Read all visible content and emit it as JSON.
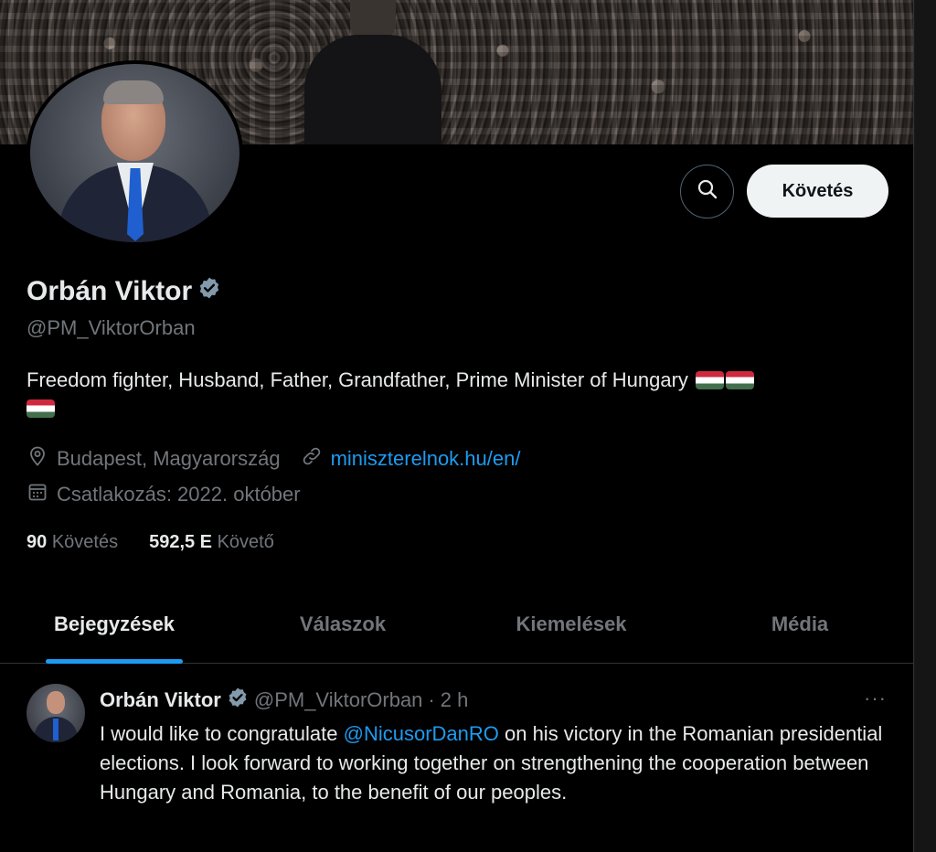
{
  "profile": {
    "name": "Orbán Viktor",
    "handle": "@PM_ViktorOrban",
    "bio": "Freedom fighter, Husband, Father, Grandfather, Prime Minister of Hungary",
    "location": "Budapest, Magyarország",
    "website": "miniszterelnok.hu/en/",
    "joined": "Csatlakozás: 2022. október",
    "following_count": "90",
    "following_label": "Követés",
    "followers_count": "592,5 E",
    "followers_label": "Követő",
    "follow_button": "Követés"
  },
  "icons": {
    "verified": "verified-badge-icon",
    "search": "search-icon",
    "location": "location-pin-icon",
    "link": "link-icon",
    "calendar": "calendar-icon",
    "more": "more-icon"
  },
  "tabs": [
    {
      "label": "Bejegyzések",
      "active": true
    },
    {
      "label": "Válaszok",
      "active": false
    },
    {
      "label": "Kiemelések",
      "active": false
    },
    {
      "label": "Média",
      "active": false
    }
  ],
  "tweet": {
    "name": "Orbán Viktor",
    "handle": "@PM_ViktorOrban",
    "separator": "·",
    "time": "2 h",
    "more": "···",
    "text_before": "I would like to congratulate ",
    "mention": "@NicusorDanRO",
    "text_after": " on his victory in the Romanian presidential elections. I look forward to working together on strengthening the cooperation between Hungary and Romania, to the benefit of our peoples."
  },
  "colors": {
    "background": "#000000",
    "accent": "#1d9bf0",
    "muted": "#71767b",
    "text": "#e7e9ea",
    "verified": "#829aab"
  }
}
